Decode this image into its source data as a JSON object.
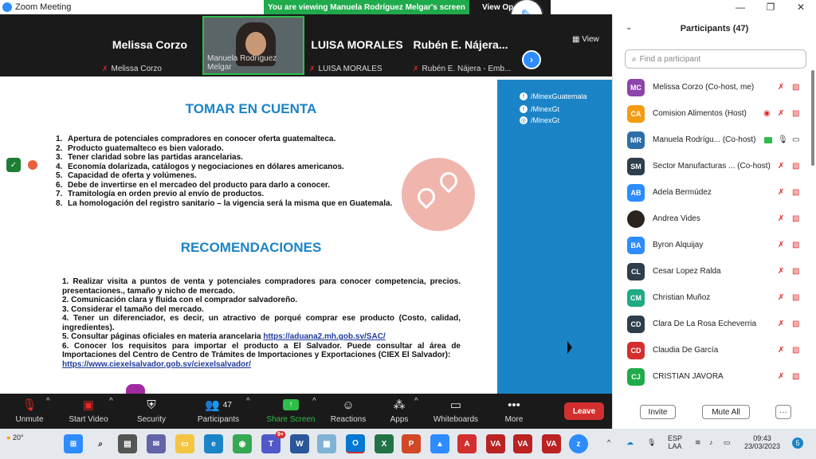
{
  "window": {
    "title": "Zoom Meeting",
    "banner": "You are viewing Manuela Rodríguez Melgar's screen",
    "view_options": "View Op"
  },
  "gallery": {
    "tiles": [
      {
        "big": "Melissa Corzo",
        "sub": "Melissa Corzo"
      },
      {
        "big": "",
        "sub": "Manuela Rodríguez Melgar"
      },
      {
        "big": "LUISA MORALES",
        "sub": "LUISA MORALES"
      },
      {
        "big": "Rubén  E. Nájera...",
        "sub": "Rubén E. Nájera - Emb..."
      }
    ],
    "view_label": "View"
  },
  "slide": {
    "social": [
      "/MinexGuatemala",
      "/MinexGt",
      "/MinexGt"
    ],
    "heading1": "TOMAR EN CUENTA",
    "items": [
      {
        "n": "1.",
        "t": "Apertura de potenciales compradores en conocer oferta guatemalteca."
      },
      {
        "n": "2.",
        "t": "Producto guatemalteco es bien valorado."
      },
      {
        "n": "3.",
        "t": "Tener claridad sobre las partidas arancelarias."
      },
      {
        "n": "4.",
        "t": "Economía dolarizada, catálogos y negociaciones en dólares americanos."
      },
      {
        "n": "5.",
        "t": "Capacidad de oferta y volúmenes."
      },
      {
        "n": "6.",
        "t": "Debe de invertirse en el mercadeo del producto para darlo a conocer."
      },
      {
        "n": "7.",
        "t": "Tramitología en orden previo al envío de productos."
      },
      {
        "n": "8.",
        "t": "La homologación del registro sanitario – la vigencia será la misma que en Guatemala."
      }
    ],
    "heading2": "RECOMENDACIONES",
    "rec": [
      "1. Realizar visita a puntos de venta y potenciales compradores para conocer competencia, precios. presentaciones., tamaño y nicho de mercado.",
      "2. Comunicación clara y fluida con el comprador salvadoreño.",
      "3. Considerar el tamaño del mercado.",
      "4. Tener un diferenciador, es decir, un atractivo de porqué comprar ese producto (Costo, calidad, ingredientes).",
      "5. Consultar páginas oficiales en materia arancelaria",
      "6. Conocer los requisitos para importar el producto a El Salvador. Puede consultar al área de Importaciones del Centro de Centro de Trámites de Importaciones y Exportaciones (CIEX El Salvador):"
    ],
    "link1": "https://aduana2.mh.gob.sv/SAC/",
    "link2": "https://www.ciexelsalvador.gob.sv/ciexelsalvador/"
  },
  "toolbar": {
    "unmute": "Unmute",
    "start_video": "Start Video",
    "security": "Security",
    "participants": "Participants",
    "participants_count": "47",
    "share": "Share Screen",
    "reactions": "Reactions",
    "apps": "Apps",
    "whiteboards": "Whiteboards",
    "more": "More",
    "leave": "Leave"
  },
  "participants_panel": {
    "title": "Participants (47)",
    "search_placeholder": "Find a participant",
    "people": [
      {
        "initials": "MC",
        "name": "Melissa Corzo (Co-host, me)",
        "color": "#8e44ad"
      },
      {
        "initials": "CA",
        "name": "Comision Alimentos (Host)",
        "color": "#f39c12"
      },
      {
        "initials": "MR",
        "name": "Manuela Rodrígu... (Co-host)",
        "color": "#2c6fa8"
      },
      {
        "initials": "SM",
        "name": "Sector Manufacturas ... (Co-host)",
        "color": "#2f3e4d"
      },
      {
        "initials": "AB",
        "name": "Adela Bermúdez",
        "color": "#2d8cff"
      },
      {
        "initials": "",
        "name": "Andrea Vides",
        "color": "#2b2320"
      },
      {
        "initials": "BA",
        "name": "Byron Alquijay",
        "color": "#2d8cff"
      },
      {
        "initials": "CL",
        "name": "Cesar Lopez Ralda",
        "color": "#2f3e4d"
      },
      {
        "initials": "CM",
        "name": "Christian Muñoz",
        "color": "#1faa85"
      },
      {
        "initials": "CD",
        "name": "Clara De La Rosa Echeverria",
        "color": "#2f3e4d"
      },
      {
        "initials": "CD",
        "name": "Claudia De García",
        "color": "#d32f2f"
      },
      {
        "initials": "CJ",
        "name": "CRISTIAN JAVORA",
        "color": "#1faa4b"
      }
    ],
    "invite": "Invite",
    "mute_all": "Mute All",
    "more": "···"
  },
  "taskbar": {
    "weather": "20°",
    "lang1": "ESP",
    "lang2": "LAA",
    "time": "09:43",
    "date": "23/03/2023",
    "notif": "5",
    "teams_badge": "9+"
  }
}
